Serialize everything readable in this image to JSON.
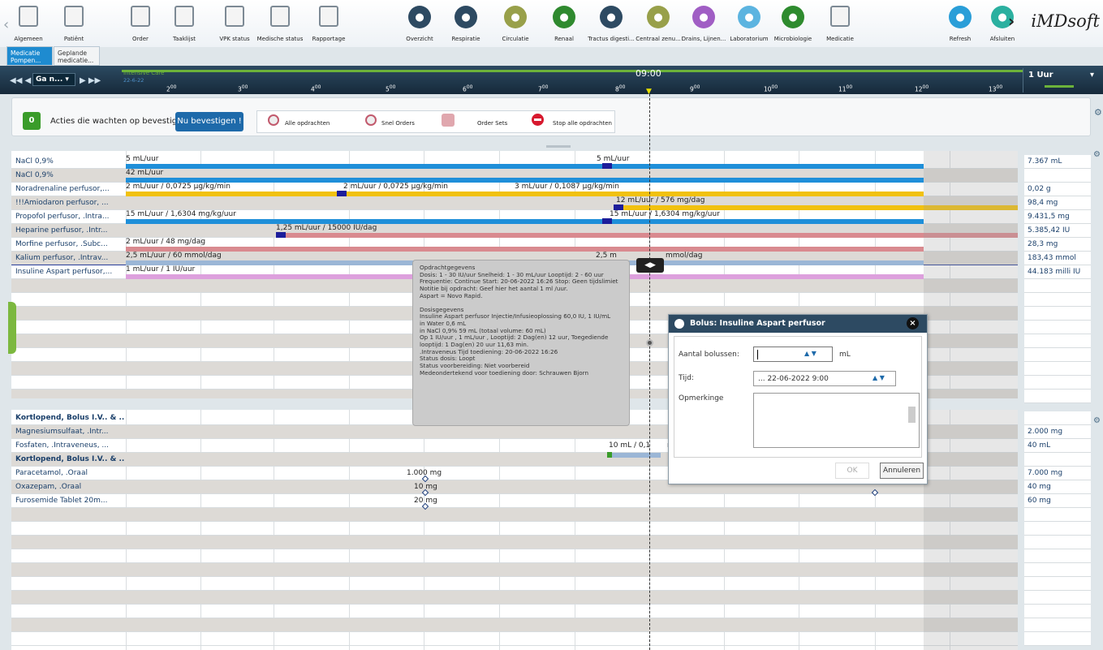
{
  "toolbar": {
    "items": [
      {
        "label": "Algemeen",
        "icon": "hospital-icon",
        "name": "algemeen"
      },
      {
        "label": "Patiënt",
        "icon": "patient-icon",
        "name": "patient"
      },
      {
        "label": "Order",
        "icon": "pill-icon",
        "name": "order"
      },
      {
        "label": "Taaklijst",
        "icon": "tasklist-icon",
        "name": "taaklijst"
      },
      {
        "label": "VPK status",
        "icon": "monitor-icon",
        "name": "vpk-status"
      },
      {
        "label": "Medische status",
        "icon": "medical-status-icon",
        "name": "medische-status"
      },
      {
        "label": "Rapportage",
        "icon": "clipboard-icon",
        "name": "rapportage"
      },
      {
        "label": "Overzicht",
        "icon": "home-icon",
        "name": "overzicht"
      },
      {
        "label": "Respiratie",
        "icon": "lungs-icon",
        "name": "respiratie"
      },
      {
        "label": "Circulatie",
        "icon": "heart-icon",
        "name": "circulatie"
      },
      {
        "label": "Renaal",
        "icon": "kidney-icon",
        "name": "renaal"
      },
      {
        "label": "Tractus digesti...",
        "icon": "stomach-icon",
        "name": "tractus-digestivus"
      },
      {
        "label": "Centraal zenu...",
        "icon": "brain-icon",
        "name": "centraal-zenuwstelsel"
      },
      {
        "label": "Drains, Lijnen...",
        "icon": "share-icon",
        "name": "drains-lijnen"
      },
      {
        "label": "Laboratorium",
        "icon": "flask-icon",
        "name": "laboratorium"
      },
      {
        "label": "Microbiologie",
        "icon": "virus-icon",
        "name": "microbiologie"
      },
      {
        "label": "Medicatie",
        "icon": "medication-icon",
        "name": "medicatie"
      },
      {
        "label": "Refresh",
        "icon": "refresh-icon",
        "name": "refresh"
      },
      {
        "label": "Afsluiten",
        "icon": "power-icon",
        "name": "afsluiten"
      }
    ],
    "brand": "iMDsoft"
  },
  "tabs": [
    {
      "label": "Medicatie Pompen..."
    },
    {
      "label": "Geplande medicatie..."
    }
  ],
  "timeline": {
    "unit": "Intensive Care",
    "date": "22-6-22",
    "time": "09:00",
    "range": "1 Uur",
    "select": "Ga n...",
    "hours": [
      "2",
      "3",
      "4",
      "5",
      "6",
      "7",
      "8",
      "9",
      "10",
      "11",
      "12",
      "13"
    ]
  },
  "actions": {
    "count": "0",
    "text": "Acties die wachten op bevestiging!",
    "confirm": "Nu bevestigen !",
    "buttons": [
      "Alle opdrachten",
      "Snel Orders",
      "Order Sets",
      "Stop alle opdrachten"
    ]
  },
  "pumps": [
    {
      "name": "NaCl 0,9%",
      "total": "7.367 mL"
    },
    {
      "name": "NaCl 0,9%",
      "total": ""
    },
    {
      "name": "Noradrenaline perfusor,...",
      "total": "0,02 g"
    },
    {
      "name": "!!!Amiodaron perfusor, ...",
      "total": "98,4 mg"
    },
    {
      "name": "Propofol perfusor, .Intra...",
      "total": "9.431,5 mg"
    },
    {
      "name": "Heparine perfusor, .Intr...",
      "total": "5.385,42 IU"
    },
    {
      "name": "Morfine perfusor, .Subc...",
      "total": "28,3 mg"
    },
    {
      "name": "Kalium perfusor, .Intrav...",
      "total": "183,43 mmol"
    },
    {
      "name": "Insuline Aspart perfusor,...",
      "total": "44.183 milli IU"
    }
  ],
  "pump_labels": [
    "5 mL/uur",
    "5 mL/uur",
    "42 mL/uur",
    "2 mL/uur / 0,0725 µg/kg/min",
    "2 mL/uur / 0,0725 µg/kg/min",
    "3 mL/uur / 0,1087 µg/kg/min",
    "12 mL/uur / 576 mg/dag",
    "15 mL/uur / 1,6304 mg/kg/uur",
    "15 mL/uur / 1,6304 mg/kg/uur",
    "1,25 mL/uur / 15000 IU/dag",
    "2 mL/uur / 48 mg/dag",
    "2,5 mL/uur / 60 mmol/dag",
    "2,5 m",
    "mmol/dag",
    "1 mL/uur / 1 IU/uur"
  ],
  "bolus": [
    {
      "name": "Kortlopend, Bolus I.V.. & ...",
      "total": "",
      "bold": true
    },
    {
      "name": "Magnesiumsulfaat, .Intr...",
      "total": "2.000 mg"
    },
    {
      "name": "Fosfaten, .Intraveneus, ...",
      "total": "40 mL"
    },
    {
      "name": "Kortlopend, Bolus I.V.. & ...",
      "total": "",
      "bold": true
    },
    {
      "name": "Paracetamol, .Oraal",
      "total": "7.000 mg"
    },
    {
      "name": "Oxazepam, .Oraal",
      "total": "40 mg"
    },
    {
      "name": "Furosemide Tablet 20m...",
      "total": "60 mg"
    }
  ],
  "bolus_labels": [
    "10 mL / 0,1",
    "mL/",
    "1.000 mg",
    "10 mg",
    "20 mg"
  ],
  "tooltip": [
    "Opdrachtgegevens",
    "Dosis: 1 - 30 IU/uur  Snelheid: 1 - 30 mL/uur  Looptijd: 2 - 60 uur",
    "Frequentie: Continue  Start: 20-06-2022 16:26  Stop: Geen tijdslimiet",
    "Notitie bij opdracht: Geef hier het aantal 1 ml /uur.",
    "Aspart = Novo Rapid.",
    "",
    "Dosisgegevens",
    "Insuline Aspart perfusor Injectie/Infusieoplossing 60,0 IU, 1 IU/mL",
    "  in  Water 0,6 mL",
    "  in NaCl 0,9% 59 mL (totaal volume: 60 mL)",
    "  Op  1 IU/uur ,  1 mL/uur , Looptijd: 2 Dag(en) 12 uur, Toegediende",
    "looptijd: 1 Dag(en) 20 uur 11,63 min.",
    ".Intraveneus Tijd toediening: 20-06-2022 16:26",
    "Status dosis: Loopt",
    "Status voorbereiding: Niet voorbereid",
    "Medeondertekend voor toediening door: Schrauwen Bjorn"
  ],
  "dialog": {
    "title": "Bolus: Insuline Aspart perfusor",
    "count_label": "Aantal bolussen:",
    "unit": "mL",
    "time_label": "Tijd:",
    "time_value": "... 22-06-2022 9:00",
    "remark_label": "Opmerkinge",
    "ok": "OK",
    "cancel": "Annuleren"
  },
  "colors": {
    "blue": "#1f8fd9",
    "yellow": "#f1c10f",
    "pink": "#d98a8f",
    "lightblue": "#9bb6d6",
    "violet": "#dda0dd",
    "green": "#3a9c2a"
  }
}
